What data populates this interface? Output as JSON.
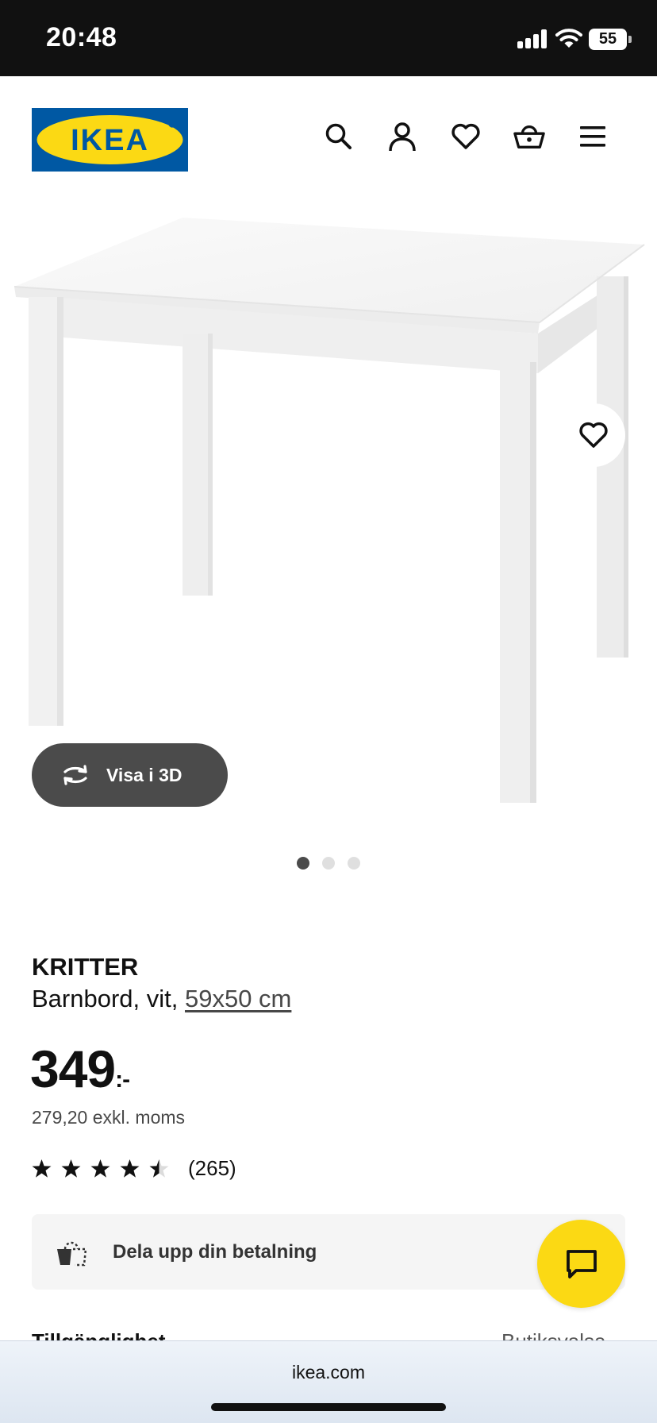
{
  "status_bar": {
    "time": "20:48",
    "battery": "55"
  },
  "header": {
    "logo_text": "IKEA",
    "icons": [
      "search-icon",
      "account-icon",
      "heart-icon",
      "basket-icon",
      "menu-icon"
    ]
  },
  "product": {
    "view_3d_label": "Visa i 3D",
    "image_count": 3,
    "active_image": 1,
    "brand": "KRITTER",
    "description": "Barnbord, vit, ",
    "size": "59x50 cm",
    "price": "349",
    "price_suffix": ":-",
    "price_excl_vat": "279,20 exkl. moms",
    "rating": 4.5,
    "review_count": "(265)"
  },
  "payment": {
    "label": "Dela upp din betalning"
  },
  "partial_section": {
    "left": "Tillgänglighet",
    "right": "Butiksvalsa"
  },
  "browser": {
    "url": "ikea.com"
  },
  "colors": {
    "ikea_blue": "#0058a3",
    "ikea_yellow": "#fbd914",
    "dark_button": "#4b4b4b"
  }
}
